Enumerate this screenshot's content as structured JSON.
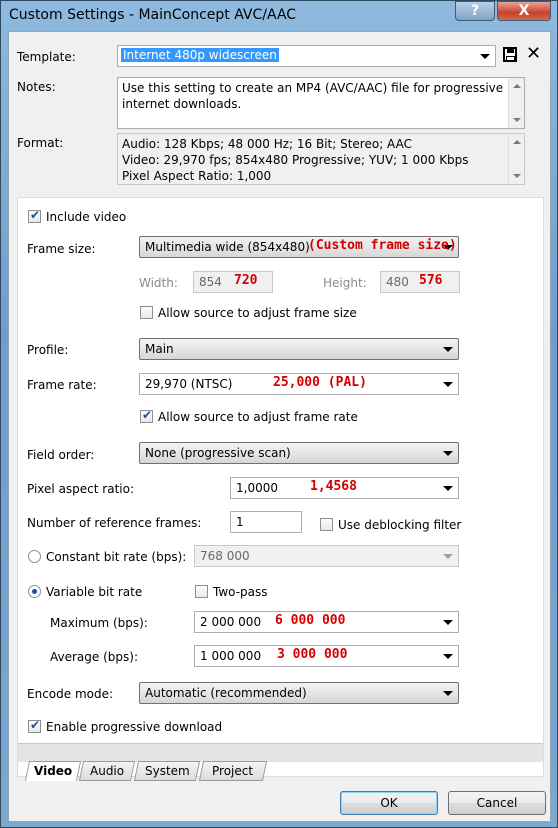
{
  "window": {
    "title": "Custom Settings - MainConcept AVC/AAC",
    "help_label": "?",
    "close_label": "X"
  },
  "template": {
    "label": "Template:",
    "value": "Internet 480p widescreen"
  },
  "notes": {
    "label": "Notes:",
    "text": "Use this setting to create an MP4 (AVC/AAC) file for progressive\ninternet downloads."
  },
  "format": {
    "label": "Format:",
    "text": "Audio: 128 Kbps; 48 000 Hz; 16 Bit; Stereo; AAC\nVideo: 29,970 fps; 854x480 Progressive; YUV; 1 000 Kbps\nPixel Aspect Ratio: 1,000"
  },
  "video": {
    "include_video": {
      "label": "Include video",
      "checked": true
    },
    "frame_size": {
      "label": "Frame size:",
      "value": "Multimedia wide (854x480)",
      "annotation": "(Custom frame size)"
    },
    "width": {
      "label": "Width:",
      "value": "854",
      "annotation": "720"
    },
    "height": {
      "label": "Height:",
      "value": "480",
      "annotation": "576"
    },
    "allow_adjust_frame_size": {
      "label": "Allow source to adjust frame size",
      "checked": false
    },
    "profile": {
      "label": "Profile:",
      "value": "Main"
    },
    "frame_rate": {
      "label": "Frame rate:",
      "value": "29,970 (NTSC)",
      "annotation": "25,000 (PAL)"
    },
    "allow_adjust_frame_rate": {
      "label": "Allow source to adjust frame rate",
      "checked": true
    },
    "field_order": {
      "label": "Field order:",
      "value": "None (progressive scan)"
    },
    "pixel_aspect": {
      "label": "Pixel aspect ratio:",
      "value": "1,0000",
      "annotation": "1,4568"
    },
    "ref_frames": {
      "label": "Number of reference frames:",
      "value": "1"
    },
    "deblocking": {
      "label": "Use deblocking filter",
      "checked": false
    },
    "cbr": {
      "label": "Constant bit rate (bps):",
      "value": "768 000",
      "selected": false
    },
    "vbr": {
      "label": "Variable bit rate",
      "selected": true
    },
    "two_pass": {
      "label": "Two-pass",
      "checked": false
    },
    "maximum": {
      "label": "Maximum (bps):",
      "value": "2 000 000",
      "annotation": "6 000 000"
    },
    "average": {
      "label": "Average (bps):",
      "value": "1 000 000",
      "annotation": "3 000 000"
    },
    "encode_mode": {
      "label": "Encode mode:",
      "value": "Automatic (recommended)"
    },
    "progressive_download": {
      "label": "Enable progressive download",
      "checked": true
    }
  },
  "tabs": [
    {
      "label": "Video",
      "active": true
    },
    {
      "label": "Audio",
      "active": false
    },
    {
      "label": "System",
      "active": false
    },
    {
      "label": "Project",
      "active": false
    }
  ],
  "buttons": {
    "ok": "OK",
    "cancel": "Cancel"
  },
  "colors": {
    "annotation": "#d20000",
    "selection": "#3399ff"
  }
}
